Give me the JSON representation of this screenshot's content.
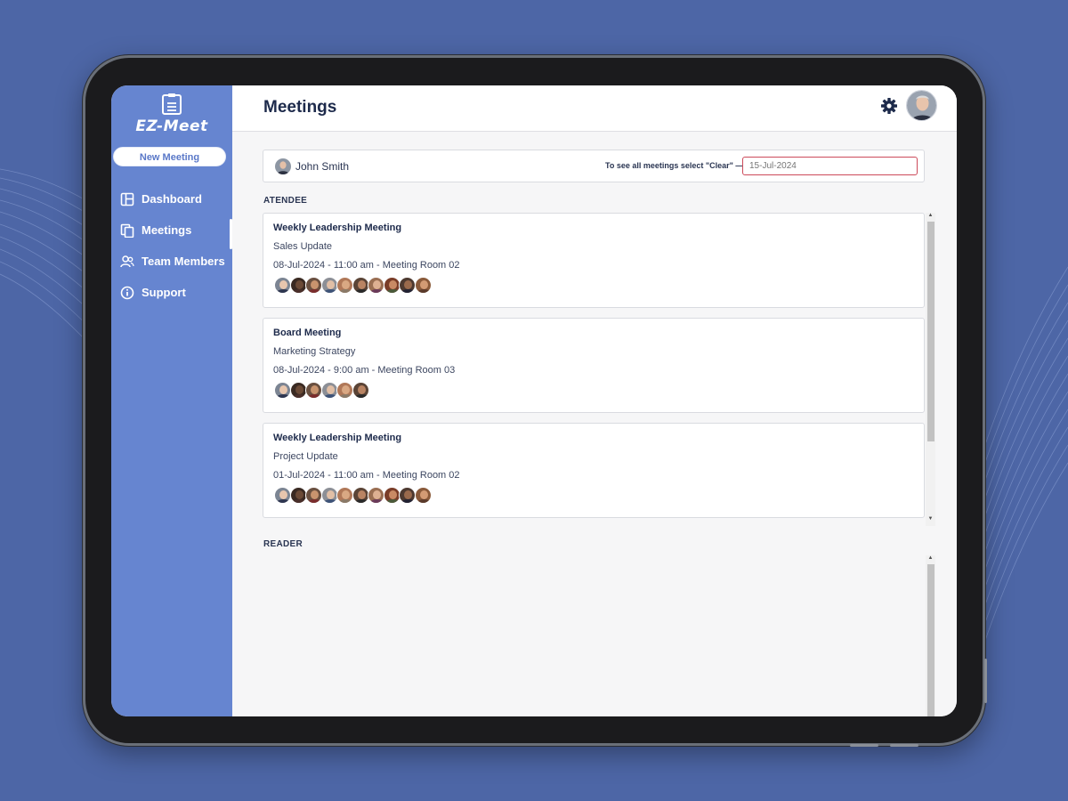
{
  "app": {
    "name": "EZ-Meet"
  },
  "sidebar": {
    "new_meeting_label": "New Meeting",
    "items": [
      {
        "label": "Dashboard",
        "icon": "dashboard-icon"
      },
      {
        "label": "Meetings",
        "icon": "meetings-icon",
        "active": true
      },
      {
        "label": "Team Members",
        "icon": "team-icon"
      },
      {
        "label": "Support",
        "icon": "info-icon"
      }
    ]
  },
  "header": {
    "title": "Meetings",
    "settings_icon": "gear-icon"
  },
  "filter": {
    "user_name": "John Smith",
    "hint": "To see all meetings select \"Clear\" —",
    "date_placeholder": "15-Jul-2024"
  },
  "sections": {
    "attendee": "ATENDEE",
    "reader": "READER"
  },
  "meetings": [
    {
      "title": "Weekly Leadership Meeting",
      "subject": "Sales Update",
      "when": "08-Jul-2024 - 11:00 am - Meeting Room 02",
      "attendee_count": 10
    },
    {
      "title": "Board Meeting",
      "subject": "Marketing Strategy",
      "when": "08-Jul-2024 - 9:00 am - Meeting Room 03",
      "attendee_count": 6
    },
    {
      "title": "Weekly Leadership Meeting",
      "subject": "Project Update",
      "when": "01-Jul-2024 - 11:00 am - Meeting Room 02",
      "attendee_count": 10
    }
  ],
  "colors": {
    "background": "#4d66a6",
    "sidebar": "#6685d0",
    "accent_text": "#1d2a4b",
    "date_border": "#cc4a5a"
  }
}
